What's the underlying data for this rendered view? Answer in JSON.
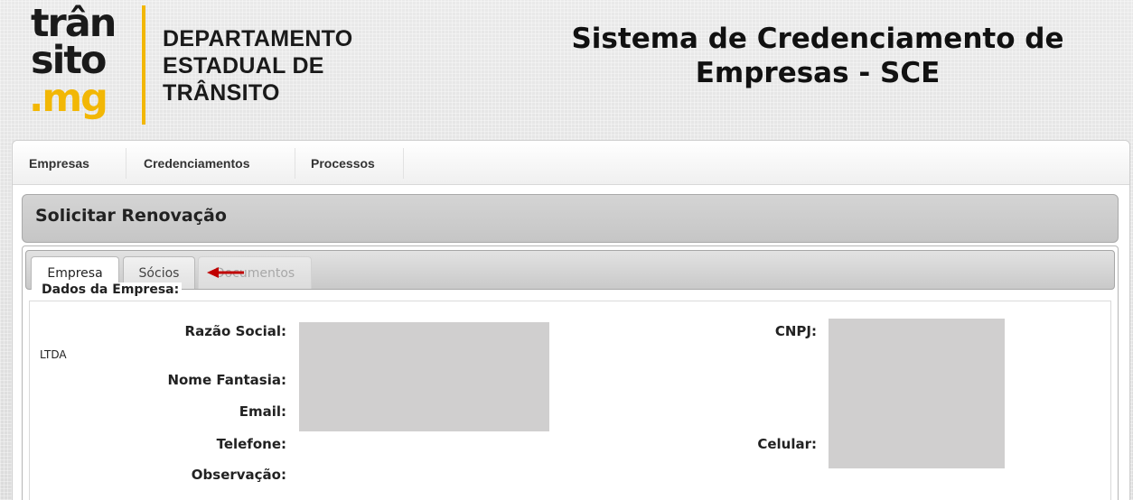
{
  "logo": {
    "line1": "trân",
    "line2": "sito",
    "line3": ".mg",
    "yellow": "#f2b705"
  },
  "department": {
    "line1": "DEPARTAMENTO",
    "line2": "ESTADUAL DE",
    "line3": "TRÂNSITO"
  },
  "system": {
    "title_line1": "Sistema de Credenciamento de",
    "title_line2": "Empresas - SCE"
  },
  "menu": {
    "items": [
      {
        "label": "Empresas"
      },
      {
        "label": "Credenciamentos"
      },
      {
        "label": "Processos"
      }
    ]
  },
  "page": {
    "title": "Solicitar Renovação"
  },
  "tabs": [
    {
      "label": "Empresa",
      "state": "active"
    },
    {
      "label": "Sócios",
      "state": "normal"
    },
    {
      "label": "Documentos",
      "state": "disabled"
    }
  ],
  "annotation": {
    "arrow_color": "#c00000"
  },
  "form": {
    "legend": "Dados da Empresa:",
    "razao_social_label": "Razão Social:",
    "razao_social_value": "LTDA",
    "nome_fantasia_label": "Nome Fantasia:",
    "email_label": "Email:",
    "telefone_label": "Telefone:",
    "observacao_label": "Observação:",
    "cnpj_label": "CNPJ:",
    "celular_label": "Celular:"
  }
}
